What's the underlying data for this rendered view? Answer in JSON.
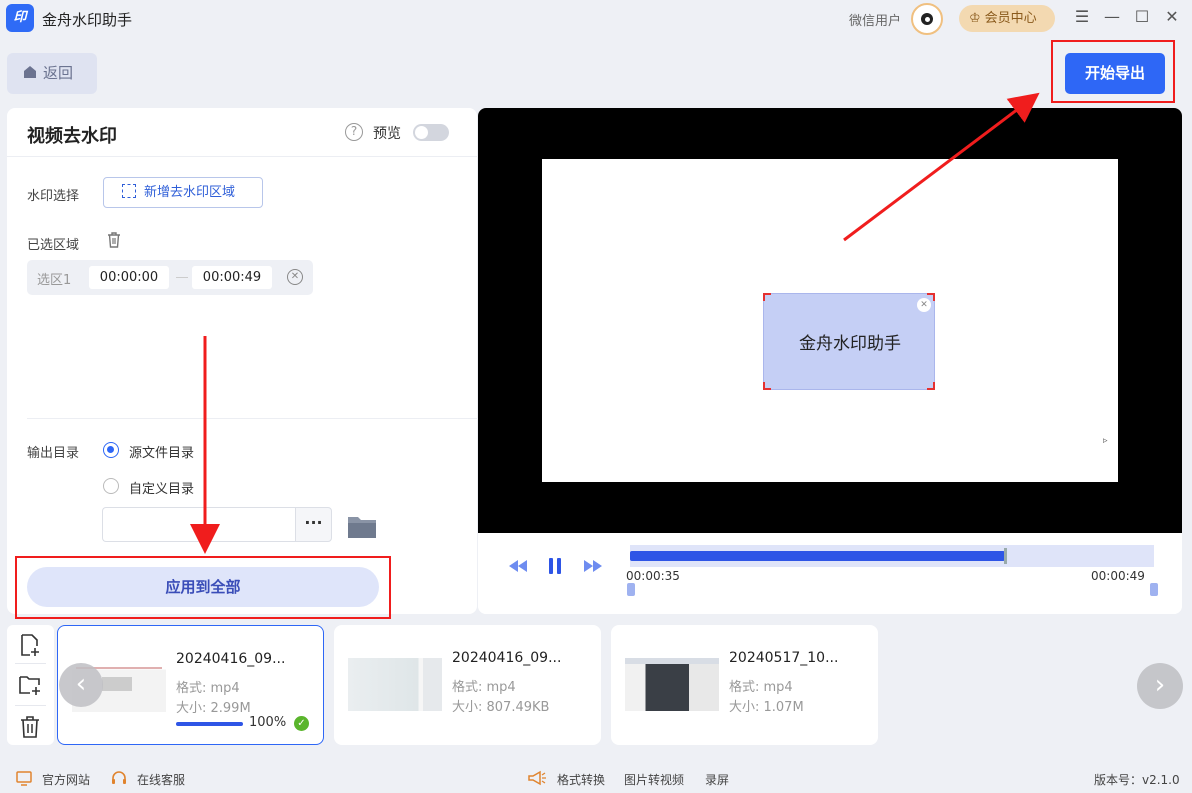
{
  "app": {
    "title": "金舟水印助手",
    "logo_text": "印"
  },
  "header": {
    "user_name": "微信用户",
    "vip_label": "会员中心",
    "window_buttons": [
      "menu-icon",
      "minimize-icon",
      "maximize-icon",
      "close-icon"
    ]
  },
  "toolbar": {
    "back_label": "返回",
    "export_label": "开始导出"
  },
  "panel": {
    "title": "视频去水印",
    "preview_label": "预览",
    "preview_enabled": false,
    "watermark_select_label": "水印选择",
    "add_region_label": "新增去水印区域",
    "selected_regions_label": "已选区域",
    "regions": [
      {
        "name": "选区1",
        "start": "00:00:00",
        "end": "00:00:49"
      }
    ],
    "output_dir_label": "输出目录",
    "output_options": [
      {
        "label": "源文件目录",
        "checked": true
      },
      {
        "label": "自定义目录",
        "checked": false
      }
    ],
    "custom_path_value": "",
    "more_button": "···",
    "apply_all_label": "应用到全部"
  },
  "video": {
    "watermark_text": "金舟水印助手",
    "current_time": "00:00:35",
    "total_time": "00:00:49",
    "progress": 0.714
  },
  "files": [
    {
      "name": "20240416_09...",
      "format": "格式: mp4",
      "size": "大小: 2.99M",
      "progress_pct": "100%",
      "progress": 1.0,
      "active": true
    },
    {
      "name": "20240416_09...",
      "format": "格式: mp4",
      "size": "大小: 807.49KB",
      "active": false
    },
    {
      "name": "20240517_10...",
      "format": "格式: mp4",
      "size": "大小: 1.07M",
      "active": false
    }
  ],
  "footer": {
    "official_site": "官方网站",
    "online_service": "在线客服",
    "format_convert": "格式转换",
    "image_to_video": "图片转视频",
    "screen_record": "录屏",
    "version": "版本号：v2.1.0"
  },
  "colors": {
    "accent": "#2e67f6",
    "annotation": "#f01d1d",
    "vip": "#f3d9b1"
  }
}
